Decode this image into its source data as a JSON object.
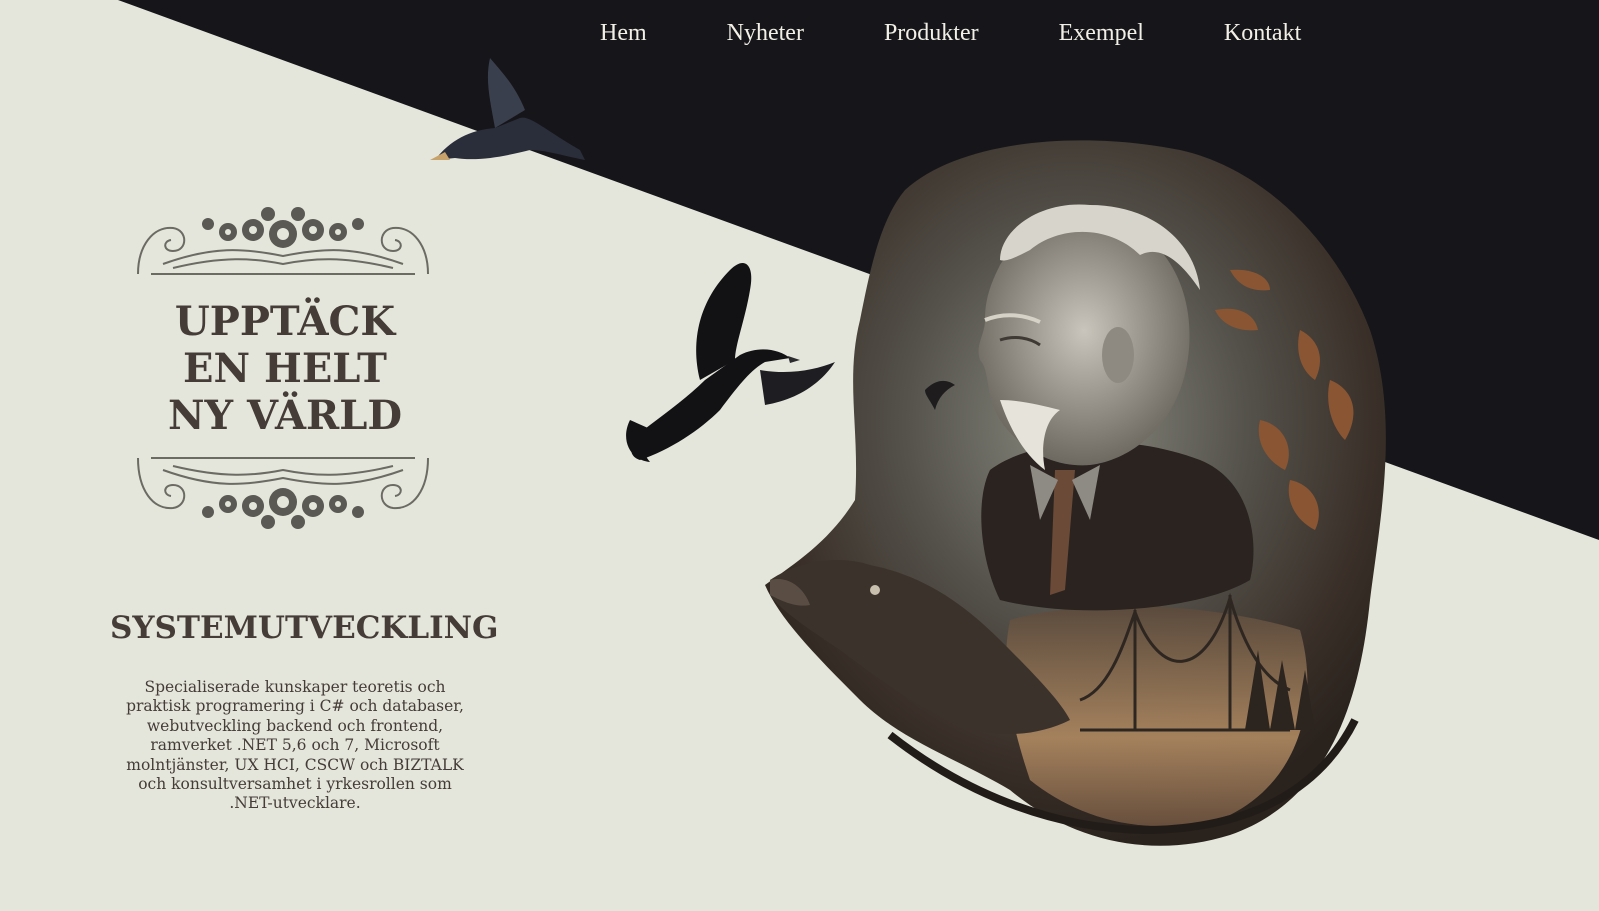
{
  "nav": {
    "items": [
      {
        "label": "Hem"
      },
      {
        "label": "Nyheter"
      },
      {
        "label": "Produkter"
      },
      {
        "label": "Exempel"
      },
      {
        "label": "Kontakt"
      }
    ]
  },
  "hero": {
    "title_lines": [
      "UPPTÄCK",
      "EN HELT",
      "NY VÄRLD"
    ]
  },
  "section": {
    "title": "SYSTEMUTVECKLING",
    "description": "Specialiserade kunskaper teoretis och praktisk programering i C# och databaser, webutveckling backend och frontend, ramverket .NET 5,6 och 7, Microsoft molntjänster, UX HCI, CSCW och BIZTALK och konsultversamhet i yrkesrollen som .NET-utvecklare."
  },
  "colors": {
    "background_light": "#e4e6dc",
    "background_dark": "#161519",
    "text_dark": "#453c37",
    "nav_text": "#f1efe6"
  },
  "icons": [
    "raven-icon",
    "ornament-frame-icon",
    "portrait-illustration"
  ]
}
